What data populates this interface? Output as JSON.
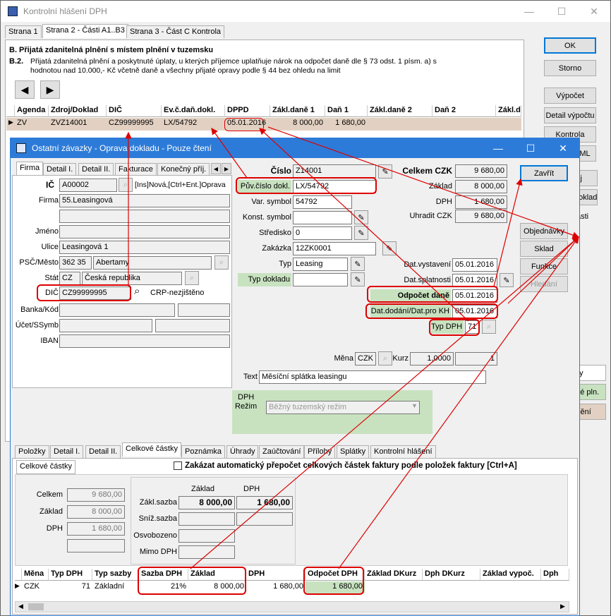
{
  "main": {
    "title": "Kontrolní hlášení DPH",
    "tabs": [
      "Strana 1",
      "Strana 2 - Části A1..B3",
      "Strana 3 - Část C Kontrola"
    ],
    "section_b": "B. Přijatá zdanitelná plnění s místem plnění v tuzemsku",
    "section_b2_num": "B.2.",
    "section_b2_line1": "Přijatá zdanitelná plnění a poskytnuté úplaty, u kterých příjemce uplatňuje nárok na odpočet daně dle § 73 odst. 1 písm. a) s",
    "section_b2_line2": "hodnotou nad 10.000,- Kč včetně daně a všechny přijaté opravy podle § 44 bez ohledu na limit",
    "buttons": {
      "ok": "OK",
      "storno": "Storno",
      "vypocet": "Výpočet",
      "detail": "Detail výpočtu",
      "kontrola": "Kontrola",
      "xml": "XML",
      "prev": "◀",
      "next": "▶"
    },
    "grid_headers": [
      "Agenda",
      "Zdroj/Doklad",
      "DIČ",
      "Ev.č.daň.dokl.",
      "DPPD",
      "Zákl.daně 1",
      "Daň 1",
      "Zákl.daně 2",
      "Daň 2",
      "Zákl.d"
    ],
    "grid_row": {
      "agenda": "ZV",
      "zdroj": "ZVZ14001",
      "dic": "CZ99999995",
      "ev": "LX/54792",
      "dppd": "05.01.2016",
      "zakl1": "8 000,00",
      "dan1": "1 680,00"
    },
    "partial_right": {
      "p1": "lej",
      "p2": "doklad",
      "p3": "ásti",
      "p4": "ty",
      "p5": "ené pln.",
      "p6": "lnění"
    }
  },
  "dialog": {
    "title": "Ostatní závazky - Oprava dokladu - Pouze čtení",
    "left_tabs": [
      "Firma",
      "Detail I.",
      "Detail II.",
      "Fakturace",
      "Konečný příj."
    ],
    "ic_label": "IČ",
    "ic_value": "A00002",
    "ic_hint": "[Ins]Nová,[Ctrl+Ent.]Oprava",
    "firma_label": "Firma",
    "firma_value": "55.Leasingová",
    "jmeno_label": "Jméno",
    "ulice_label": "Ulice",
    "ulice_value": "Leasingová 1",
    "psc_label": "PSČ/Město",
    "psc_value": "362 35",
    "mesto_value": "Abertamy",
    "stat_label": "Stát",
    "stat_code": "CZ",
    "stat_name": "Česká republika",
    "dic_label": "DIČ",
    "dic_value": "CZ99999995",
    "crp": "CRP-nezjištěno",
    "banka_label": "Banka/Kód",
    "ucet_label": "Účet/SSymb",
    "iban_label": "IBAN",
    "cislo_label": "Číslo",
    "cislo_value": "Z14001",
    "puv_label": "Pův.číslo dokl.",
    "puv_value": "LX/54792",
    "var_label": "Var. symbol",
    "var_value": "54792",
    "konst_label": "Konst. symbol",
    "stredisko_label": "Středisko",
    "stredisko_value": "0",
    "zakazka_label": "Zakázka",
    "zakazka_value": "12ZK0001",
    "typ_label": "Typ",
    "typ_value": "Leasing",
    "typdokl_label": "Typ dokladu",
    "celkem_label": "Celkem CZK",
    "celkem_value": "9 680,00",
    "zaklad_label": "Základ",
    "zaklad_value": "8 000,00",
    "dph_label": "DPH",
    "dph_value": "1 680,00",
    "uhradit_label": "Uhradit CZK",
    "uhradit_value": "9 680,00",
    "datvyst_label": "Dat.vystavení",
    "datvyst_value": "05.01.2016",
    "datspl_label": "Dat.splatnosti",
    "datspl_value": "05.01.2016",
    "odpocet_label": "Odpočet daně",
    "odpocet_value": "05.01.2016",
    "datdod_label": "Dat.dodání/Dat.pro KH",
    "datdod_value": "05.01.2016",
    "typdph_label": "Typ DPH",
    "typdph_value": "71",
    "mena_label": "Měna",
    "mena_value": "CZK",
    "kurz_label": "Kurz",
    "kurz1": "1,0000",
    "kurz2": "1",
    "text_label": "Text",
    "text_value": "Měsíční splátka leasingu",
    "dph_rezim_title": "DPH",
    "rezim_label": "Režim",
    "rezim_value": "Běžný tuzemský režim",
    "buttons": {
      "zavrit": "Zavřít",
      "objednavky": "Objednávky",
      "sklad": "Sklad",
      "funkce": "Funkce",
      "hledani": "Hledání"
    },
    "bottom_tabs": [
      "Položky",
      "Detail I.",
      "Detail II.",
      "Celkové částky",
      "Poznámka",
      "Úhrady",
      "Zaúčtování",
      "Přílohy",
      "Splátky",
      "Kontrolní hlášení"
    ],
    "subtab": "Celkové částky",
    "checkbox_label": "Zakázat automatický přepočet celkových částek faktury podle položek faktury [Ctrl+A]",
    "sum_celkem_label": "Celkem",
    "sum_celkem": "9 680,00",
    "sum_zaklad_label": "Základ",
    "sum_zaklad": "8 000,00",
    "sum_dph_label": "DPH",
    "sum_dph": "1 680,00",
    "col_zaklad": "Základ",
    "col_dph": "DPH",
    "zakl_sazba_label": "Zákl.sazba",
    "zakl_sazba_zaklad": "8 000,00",
    "zakl_sazba_dph": "1 680,00",
    "sniz_label": "Sníž.sazba",
    "osvob_label": "Osvobozeno",
    "mimo_label": "Mimo DPH",
    "grid_headers": [
      "Měna",
      "Typ DPH",
      "Typ sazby",
      "Sazba DPH",
      "Základ",
      "DPH",
      "Odpočet DPH",
      "Základ DKurz",
      "Dph DKurz",
      "Základ vypoč.",
      "Dph"
    ],
    "grid_row": {
      "mena": "CZK",
      "typdph": "71",
      "typsazby": "Základní",
      "sazba": "21%",
      "zaklad": "8 000,00",
      "dph": "1 680,00",
      "odpocet": "1 680,00"
    }
  }
}
